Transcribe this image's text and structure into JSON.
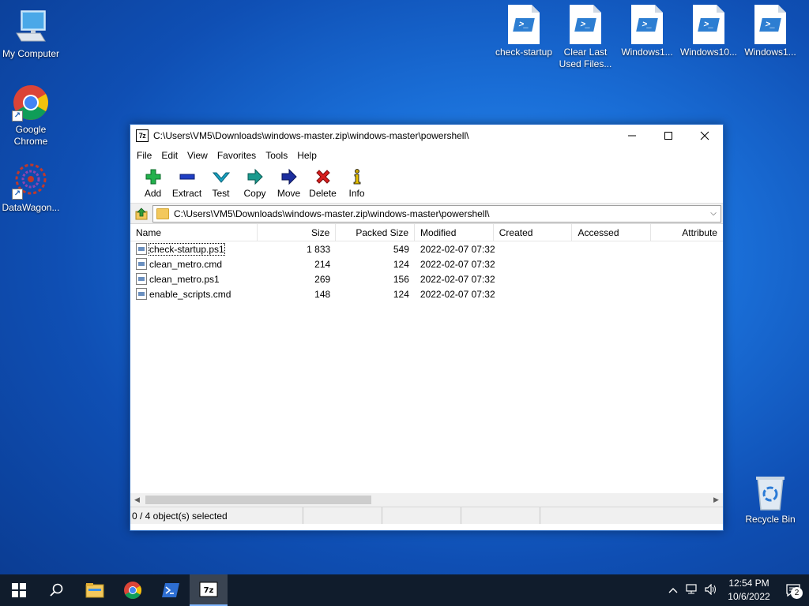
{
  "desktop": {
    "left_icons": [
      {
        "label": "My Computer"
      },
      {
        "label": "Google Chrome"
      },
      {
        "label": "DataWagon..."
      }
    ],
    "top_icons": [
      {
        "label": "check-startup"
      },
      {
        "label": "Clear Last Used Files..."
      },
      {
        "label": "Windows1..."
      },
      {
        "label": "Windows10..."
      },
      {
        "label": "Windows1..."
      }
    ],
    "recycle_bin": {
      "label": "Recycle Bin"
    }
  },
  "window": {
    "app_icon_text": "7z",
    "title": "C:\\Users\\VM5\\Downloads\\windows-master.zip\\windows-master\\powershell\\",
    "menu": [
      "File",
      "Edit",
      "View",
      "Favorites",
      "Tools",
      "Help"
    ],
    "toolbar": [
      {
        "label": "Add",
        "icon": "plus-icon",
        "color": "#22b14c"
      },
      {
        "label": "Extract",
        "icon": "minus-icon",
        "color": "#1f3fc4"
      },
      {
        "label": "Test",
        "icon": "check-icon",
        "color": "#19a3c2"
      },
      {
        "label": "Copy",
        "icon": "copy-arrow-icon",
        "color": "#1a9a8e"
      },
      {
        "label": "Move",
        "icon": "move-arrow-icon",
        "color": "#1c2e9e"
      },
      {
        "label": "Delete",
        "icon": "x-icon",
        "color": "#d81f1f"
      },
      {
        "label": "Info",
        "icon": "info-icon",
        "color": "#c7a200"
      }
    ],
    "address": "C:\\Users\\VM5\\Downloads\\windows-master.zip\\windows-master\\powershell\\",
    "columns": [
      "Name",
      "Size",
      "Packed Size",
      "Modified",
      "Created",
      "Accessed",
      "Attribute"
    ],
    "files": [
      {
        "name": "check-startup.ps1",
        "size": "1 833",
        "packed": "549",
        "modified": "2022-02-07 07:32",
        "created": "",
        "accessed": "",
        "attr": ""
      },
      {
        "name": "clean_metro.cmd",
        "size": "214",
        "packed": "124",
        "modified": "2022-02-07 07:32",
        "created": "",
        "accessed": "",
        "attr": ""
      },
      {
        "name": "clean_metro.ps1",
        "size": "269",
        "packed": "156",
        "modified": "2022-02-07 07:32",
        "created": "",
        "accessed": "",
        "attr": ""
      },
      {
        "name": "enable_scripts.cmd",
        "size": "148",
        "packed": "124",
        "modified": "2022-02-07 07:32",
        "created": "",
        "accessed": "",
        "attr": ""
      }
    ],
    "status": "0 / 4 object(s) selected"
  },
  "taskbar": {
    "apps": [
      "start-icon",
      "search-icon",
      "file-explorer-icon",
      "chrome-icon",
      "powershell-icon",
      "7zip-icon"
    ],
    "clock_time": "12:54 PM",
    "clock_date": "10/6/2022",
    "notification_count": "2"
  },
  "colors": {
    "accent": "#2b6cc4",
    "taskbar": "#101c2c"
  }
}
